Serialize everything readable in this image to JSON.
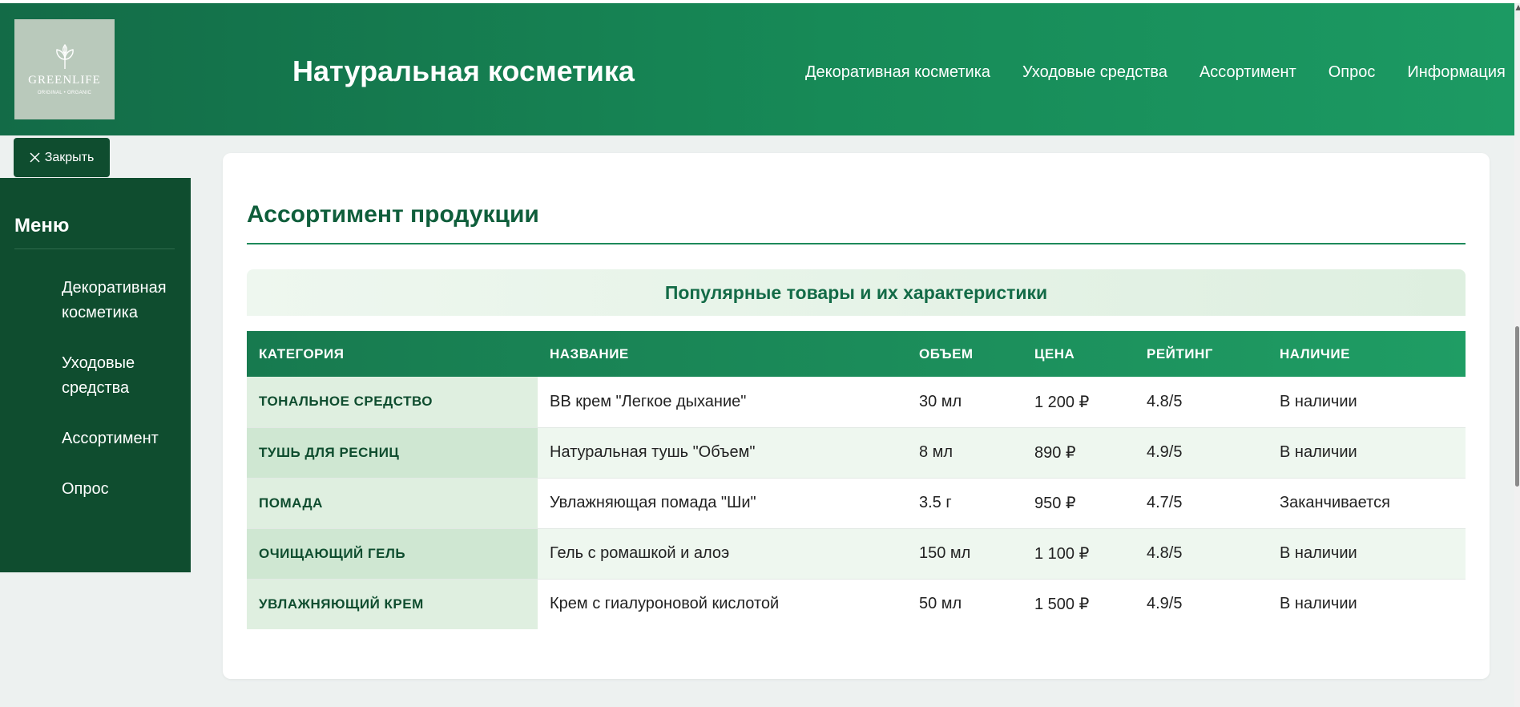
{
  "header": {
    "logo": {
      "brand": "GREENLIFE",
      "tagline": "ORIGINAL • ORGANIC",
      "icon": "leaf-icon"
    },
    "site_title": "Натуральная косметика",
    "nav": [
      "Декоративная косметика",
      "Уходовые средства",
      "Ассортимент",
      "Опрос",
      "Информация"
    ]
  },
  "sidebar": {
    "close_label": "Закрыть",
    "close_icon": "close-icon",
    "title": "Меню",
    "items": [
      {
        "label": "Декоративная косметика"
      },
      {
        "label": "Уходовые средства"
      },
      {
        "label": "Ассортимент"
      },
      {
        "label": "Опрос"
      }
    ]
  },
  "main": {
    "heading": "Ассортимент продукции",
    "caption": "Популярные товары и их характеристики",
    "table": {
      "headers": [
        "КАТЕГОРИЯ",
        "НАЗВАНИЕ",
        "ОБЪЕМ",
        "ЦЕНА",
        "РЕЙТИНГ",
        "НАЛИЧИЕ"
      ],
      "rows": [
        [
          "ТОНАЛЬНОЕ СРЕДСТВО",
          "BB крем \"Легкое дыхание\"",
          "30 мл",
          "1 200 ₽",
          "4.8/5",
          "В наличии"
        ],
        [
          "ТУШЬ ДЛЯ РЕСНИЦ",
          "Натуральная тушь \"Объем\"",
          "8 мл",
          "890 ₽",
          "4.9/5",
          "В наличии"
        ],
        [
          "ПОМАДА",
          "Увлажняющая помада \"Ши\"",
          "3.5 г",
          "950 ₽",
          "4.7/5",
          "Заканчивается"
        ],
        [
          "ОЧИЩАЮЩИЙ ГЕЛЬ",
          "Гель с ромашкой и алоэ",
          "150 мл",
          "1 100 ₽",
          "4.8/5",
          "В наличии"
        ],
        [
          "УВЛАЖНЯЮЩИЙ КРЕМ",
          "Крем с гиалуроновой кислотой",
          "50 мл",
          "1 500 ₽",
          "4.9/5",
          "В наличии"
        ]
      ]
    }
  },
  "colors": {
    "header_green": "#178a57",
    "sidebar_dark": "#0f4d2f",
    "heading_green": "#0f5e3b",
    "background": "#edf1f0"
  }
}
